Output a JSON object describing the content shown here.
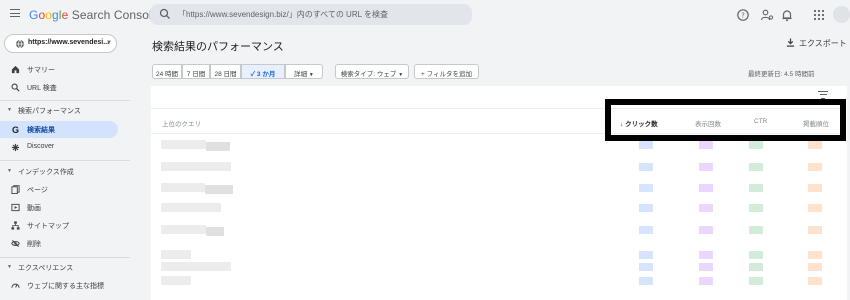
{
  "app": {
    "logo_parts": [
      "G",
      "o",
      "o",
      "g",
      "l",
      "e"
    ],
    "logo_rest": " Search Console"
  },
  "search": {
    "placeholder": "「https://www.sevendesign.biz/」内のすべての URL を検査"
  },
  "property": {
    "label": "https://www.sevendesi..."
  },
  "sidebar": {
    "items": [
      {
        "label": "サマリー",
        "icon": "home-icon"
      },
      {
        "label": "URL 検査",
        "icon": "search-icon"
      }
    ],
    "sections": [
      {
        "label": "検索パフォーマンス",
        "items": [
          {
            "label": "検索結果",
            "icon": "google-g-icon",
            "active": true
          },
          {
            "label": "Discover",
            "icon": "asterisk-icon"
          }
        ]
      },
      {
        "label": "インデックス作成",
        "items": [
          {
            "label": "ページ",
            "icon": "pages-icon"
          },
          {
            "label": "動画",
            "icon": "video-icon"
          },
          {
            "label": "サイトマップ",
            "icon": "sitemap-icon"
          },
          {
            "label": "削除",
            "icon": "hidden-eye-icon"
          }
        ]
      },
      {
        "label": "エクスペリエンス",
        "items": [
          {
            "label": "ウェブに関する主な指標",
            "icon": "speed-gauge-icon"
          }
        ]
      }
    ]
  },
  "main": {
    "title": "検索結果のパフォーマンス",
    "export_label": "エクスポート",
    "updated": "最終更新日: 4.5 時間前",
    "date_chips": [
      "24 時間",
      "7 日間",
      "28 日間",
      "3 か月",
      "詳細"
    ],
    "selected_chip_check": "✓",
    "search_type": "検索タイプ: ウェブ",
    "add_filter": "+ フィルタを追加"
  },
  "table": {
    "query_header": "上位のクエリ",
    "columns": [
      "クリック数",
      "表示回数",
      "CTR",
      "掲載順位"
    ],
    "sort_arrow": "↓",
    "row_count": 8
  },
  "colors": {
    "accent": "#1a73e8",
    "active_nav_bg": "#d3e3fd",
    "clicks": "#8ab4f8",
    "impressions": "#c58af9",
    "ctr": "#81c995",
    "position": "#fcad70"
  }
}
